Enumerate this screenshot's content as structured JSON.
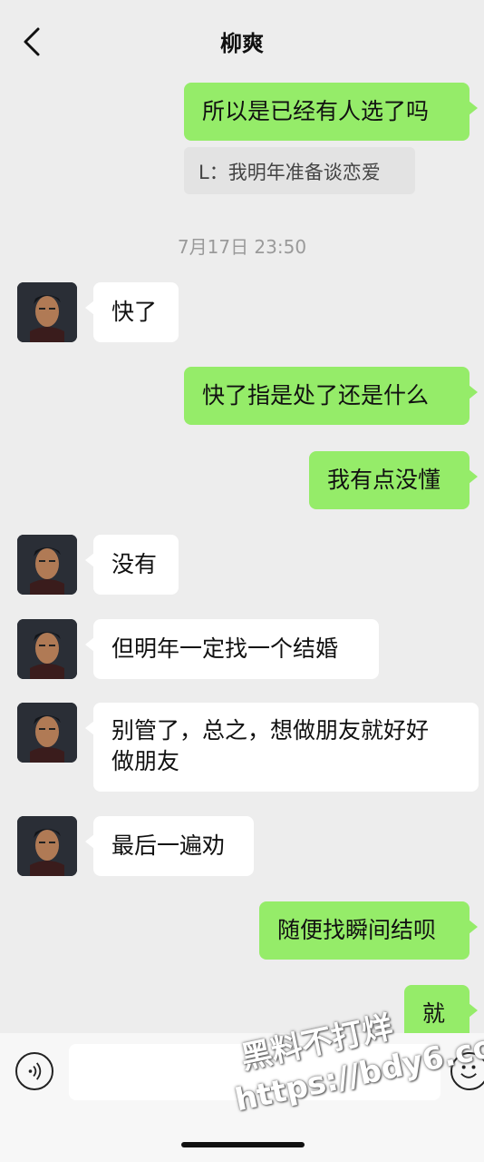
{
  "header": {
    "title": "柳爽"
  },
  "messages": {
    "m1": "所以是已经有人选了吗",
    "quote": "L：我明年准备谈恋爱",
    "time": "7月17日 23:50",
    "m2": "快了",
    "m3": "快了指是处了还是什么",
    "m4": "我有点没懂",
    "m5": "没有",
    "m6": "但明年一定找一个结婚",
    "m7_line1": "别管了，总之，想做朋友就好好",
    "m7_line2": "做朋友",
    "m8": "最后一遍劝",
    "m9": "随便找瞬间结呗",
    "m10": "就"
  },
  "watermark": {
    "line1": "黑料不打烊",
    "line2": "https://bdy6.co"
  },
  "colors": {
    "sent_bubble": "#95ec69",
    "received_bubble": "#ffffff",
    "background": "#ededed"
  },
  "icons": [
    "back-arrow-icon",
    "voice-icon",
    "emoji-icon"
  ]
}
